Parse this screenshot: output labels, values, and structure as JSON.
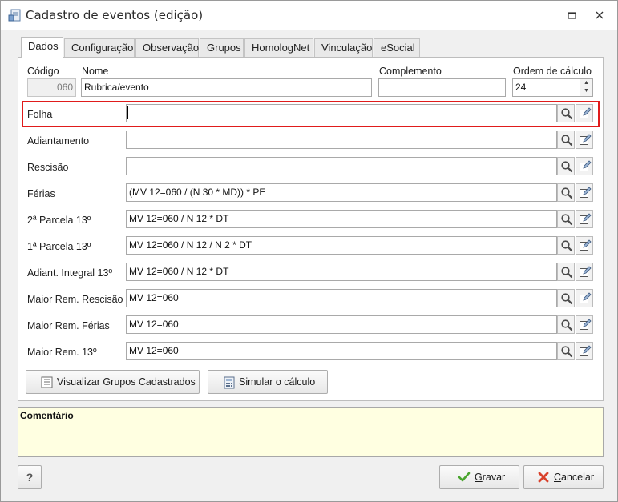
{
  "window": {
    "title": "Cadastro de eventos (edição)"
  },
  "tabs": [
    "Dados",
    "Configuração",
    "Observação",
    "Grupos",
    "HomologNet",
    "Vinculação",
    "eSocial"
  ],
  "active_tab": "Dados",
  "header": {
    "codigo_label": "Código",
    "codigo_value": "060",
    "nome_label": "Nome",
    "nome_value": "Rubrica/evento",
    "complemento_label": "Complemento",
    "complemento_value": "",
    "ordem_label": "Ordem de cálculo",
    "ordem_value": "24"
  },
  "formulas": [
    {
      "label": "Folha",
      "value": ""
    },
    {
      "label": "Adiantamento",
      "value": ""
    },
    {
      "label": "Rescisão",
      "value": ""
    },
    {
      "label": "Férias",
      "value": "(MV 12=060 / (N 30 * MD)) * PE"
    },
    {
      "label": "2ª Parcela 13º",
      "value": "MV 12=060 / N 12 * DT"
    },
    {
      "label": "1ª Parcela 13º",
      "value": "MV 12=060 / N 12 / N 2 * DT"
    },
    {
      "label": "Adiant. Integral 13º",
      "value": "MV 12=060 / N 12 * DT"
    },
    {
      "label": "Maior Rem. Rescisão",
      "value": "MV 12=060"
    },
    {
      "label": "Maior Rem. Férias",
      "value": "MV 12=060"
    },
    {
      "label": "Maior Rem. 13º",
      "value": "MV 12=060"
    }
  ],
  "buttons": {
    "visualizar": "Visualizar Grupos Cadastrados",
    "simular": "Simular o cálculo",
    "help": "?",
    "gravar_mnemonic": "G",
    "gravar_rest": "ravar",
    "cancelar_mnemonic": "C",
    "cancelar_rest": "ancelar"
  },
  "comment": {
    "title": "Comentário",
    "text": ""
  },
  "colors": {
    "highlight": "#e01b1b",
    "comment_bg": "#ffffe1",
    "panel_bg": "#ffffff",
    "window_bg": "#f0f0f0"
  }
}
